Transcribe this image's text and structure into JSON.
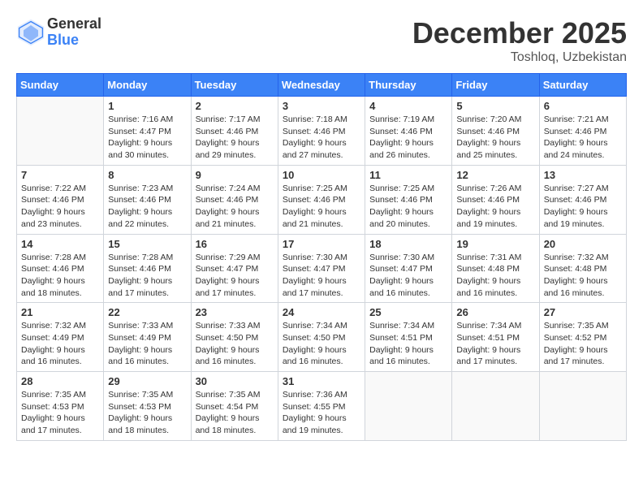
{
  "header": {
    "logo_general": "General",
    "logo_blue": "Blue",
    "month_title": "December 2025",
    "location": "Toshloq, Uzbekistan"
  },
  "calendar": {
    "days_of_week": [
      "Sunday",
      "Monday",
      "Tuesday",
      "Wednesday",
      "Thursday",
      "Friday",
      "Saturday"
    ],
    "weeks": [
      [
        {
          "day": "",
          "sunrise": "",
          "sunset": "",
          "daylight": ""
        },
        {
          "day": "1",
          "sunrise": "7:16 AM",
          "sunset": "4:47 PM",
          "daylight": "9 hours and 30 minutes."
        },
        {
          "day": "2",
          "sunrise": "7:17 AM",
          "sunset": "4:46 PM",
          "daylight": "9 hours and 29 minutes."
        },
        {
          "day": "3",
          "sunrise": "7:18 AM",
          "sunset": "4:46 PM",
          "daylight": "9 hours and 27 minutes."
        },
        {
          "day": "4",
          "sunrise": "7:19 AM",
          "sunset": "4:46 PM",
          "daylight": "9 hours and 26 minutes."
        },
        {
          "day": "5",
          "sunrise": "7:20 AM",
          "sunset": "4:46 PM",
          "daylight": "9 hours and 25 minutes."
        },
        {
          "day": "6",
          "sunrise": "7:21 AM",
          "sunset": "4:46 PM",
          "daylight": "9 hours and 24 minutes."
        }
      ],
      [
        {
          "day": "7",
          "sunrise": "7:22 AM",
          "sunset": "4:46 PM",
          "daylight": "9 hours and 23 minutes."
        },
        {
          "day": "8",
          "sunrise": "7:23 AM",
          "sunset": "4:46 PM",
          "daylight": "9 hours and 22 minutes."
        },
        {
          "day": "9",
          "sunrise": "7:24 AM",
          "sunset": "4:46 PM",
          "daylight": "9 hours and 21 minutes."
        },
        {
          "day": "10",
          "sunrise": "7:25 AM",
          "sunset": "4:46 PM",
          "daylight": "9 hours and 21 minutes."
        },
        {
          "day": "11",
          "sunrise": "7:25 AM",
          "sunset": "4:46 PM",
          "daylight": "9 hours and 20 minutes."
        },
        {
          "day": "12",
          "sunrise": "7:26 AM",
          "sunset": "4:46 PM",
          "daylight": "9 hours and 19 minutes."
        },
        {
          "day": "13",
          "sunrise": "7:27 AM",
          "sunset": "4:46 PM",
          "daylight": "9 hours and 19 minutes."
        }
      ],
      [
        {
          "day": "14",
          "sunrise": "7:28 AM",
          "sunset": "4:46 PM",
          "daylight": "9 hours and 18 minutes."
        },
        {
          "day": "15",
          "sunrise": "7:28 AM",
          "sunset": "4:46 PM",
          "daylight": "9 hours and 17 minutes."
        },
        {
          "day": "16",
          "sunrise": "7:29 AM",
          "sunset": "4:47 PM",
          "daylight": "9 hours and 17 minutes."
        },
        {
          "day": "17",
          "sunrise": "7:30 AM",
          "sunset": "4:47 PM",
          "daylight": "9 hours and 17 minutes."
        },
        {
          "day": "18",
          "sunrise": "7:30 AM",
          "sunset": "4:47 PM",
          "daylight": "9 hours and 16 minutes."
        },
        {
          "day": "19",
          "sunrise": "7:31 AM",
          "sunset": "4:48 PM",
          "daylight": "9 hours and 16 minutes."
        },
        {
          "day": "20",
          "sunrise": "7:32 AM",
          "sunset": "4:48 PM",
          "daylight": "9 hours and 16 minutes."
        }
      ],
      [
        {
          "day": "21",
          "sunrise": "7:32 AM",
          "sunset": "4:49 PM",
          "daylight": "9 hours and 16 minutes."
        },
        {
          "day": "22",
          "sunrise": "7:33 AM",
          "sunset": "4:49 PM",
          "daylight": "9 hours and 16 minutes."
        },
        {
          "day": "23",
          "sunrise": "7:33 AM",
          "sunset": "4:50 PM",
          "daylight": "9 hours and 16 minutes."
        },
        {
          "day": "24",
          "sunrise": "7:34 AM",
          "sunset": "4:50 PM",
          "daylight": "9 hours and 16 minutes."
        },
        {
          "day": "25",
          "sunrise": "7:34 AM",
          "sunset": "4:51 PM",
          "daylight": "9 hours and 16 minutes."
        },
        {
          "day": "26",
          "sunrise": "7:34 AM",
          "sunset": "4:51 PM",
          "daylight": "9 hours and 17 minutes."
        },
        {
          "day": "27",
          "sunrise": "7:35 AM",
          "sunset": "4:52 PM",
          "daylight": "9 hours and 17 minutes."
        }
      ],
      [
        {
          "day": "28",
          "sunrise": "7:35 AM",
          "sunset": "4:53 PM",
          "daylight": "9 hours and 17 minutes."
        },
        {
          "day": "29",
          "sunrise": "7:35 AM",
          "sunset": "4:53 PM",
          "daylight": "9 hours and 18 minutes."
        },
        {
          "day": "30",
          "sunrise": "7:35 AM",
          "sunset": "4:54 PM",
          "daylight": "9 hours and 18 minutes."
        },
        {
          "day": "31",
          "sunrise": "7:36 AM",
          "sunset": "4:55 PM",
          "daylight": "9 hours and 19 minutes."
        },
        {
          "day": "",
          "sunrise": "",
          "sunset": "",
          "daylight": ""
        },
        {
          "day": "",
          "sunrise": "",
          "sunset": "",
          "daylight": ""
        },
        {
          "day": "",
          "sunrise": "",
          "sunset": "",
          "daylight": ""
        }
      ]
    ]
  }
}
